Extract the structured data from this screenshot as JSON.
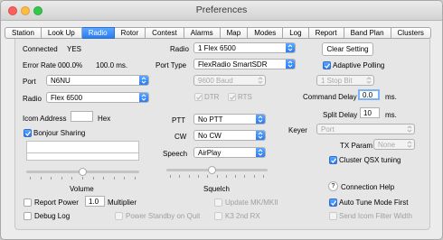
{
  "window": {
    "title": "Preferences"
  },
  "tabs": [
    {
      "label": "Station",
      "active": false
    },
    {
      "label": "Look Up",
      "active": false
    },
    {
      "label": "Radio",
      "active": true
    },
    {
      "label": "Rotor",
      "active": false
    },
    {
      "label": "Contest",
      "active": false
    },
    {
      "label": "Alarms",
      "active": false
    },
    {
      "label": "Map",
      "active": false
    },
    {
      "label": "Modes",
      "active": false
    },
    {
      "label": "Log",
      "active": false
    },
    {
      "label": "Report",
      "active": false
    },
    {
      "label": "Band Plan",
      "active": false
    },
    {
      "label": "Clusters",
      "active": false
    }
  ],
  "left": {
    "connected_label": "Connected",
    "connected_value": "YES",
    "error_rate_label": "Error Rate",
    "error_rate_value": "000.0%",
    "error_rate_ms": "100.0 ms.",
    "port_label": "Port",
    "port_value": "N6NU",
    "radio_label": "Radio",
    "radio_value": "Flex 6500",
    "icom_address_label": "Icom Address",
    "icom_address_value": "",
    "icom_hex_label": "Hex",
    "bonjour_label": "Bonjour Sharing",
    "bonjour_checked": true,
    "volume_label": "Volume",
    "volume_level": 0.5,
    "report_power_label": "Report Power",
    "report_power_value": "1.0",
    "multiplier_label": "Multiplier",
    "debug_log_label": "Debug Log",
    "power_standby_label": "Power Standby on Quit"
  },
  "middle": {
    "radio_label": "Radio",
    "radio_value": "1 Flex 6500",
    "port_type_label": "Port Type",
    "port_type_value": "FlexRadio SmartSDR",
    "baud_value": "9600 Baud",
    "dtr_label": "DTR",
    "rts_label": "RTS",
    "ptt_label": "PTT",
    "ptt_value": "No PTT",
    "cw_label": "CW",
    "cw_value": "No CW",
    "speech_label": "Speech",
    "speech_value": "AirPlay",
    "squelch_label": "Squelch",
    "squelch_level": 0.45,
    "update_mk_label": "Update MK/MKII",
    "k3_rx_label": "K3 2nd RX"
  },
  "right": {
    "clear_setting_label": "Clear Setting",
    "adaptive_polling_label": "Adaptive Polling",
    "adaptive_polling_checked": true,
    "stop_bit_value": "1 Stop Bit",
    "command_delay_label": "Command Delay",
    "command_delay_value": "0.0",
    "command_delay_unit": "ms.",
    "split_delay_label": "Split Delay",
    "split_delay_value": "10",
    "split_delay_unit": "ms.",
    "keyer_label": "Keyer",
    "keyer_value": "Port",
    "tx_param_label": "TX Param",
    "tx_param_value": "None",
    "cluster_qsx_label": "Cluster QSX tuning",
    "cluster_qsx_checked": true,
    "connection_help_label": "Connection Help",
    "connection_help_icon": "?",
    "auto_tune_label": "Auto Tune Mode First",
    "auto_tune_checked": true,
    "send_icom_filter_label": "Send Icom Filter Width"
  },
  "colors": {
    "accent": "#2b7cf0",
    "window_bg": "#ececec"
  }
}
